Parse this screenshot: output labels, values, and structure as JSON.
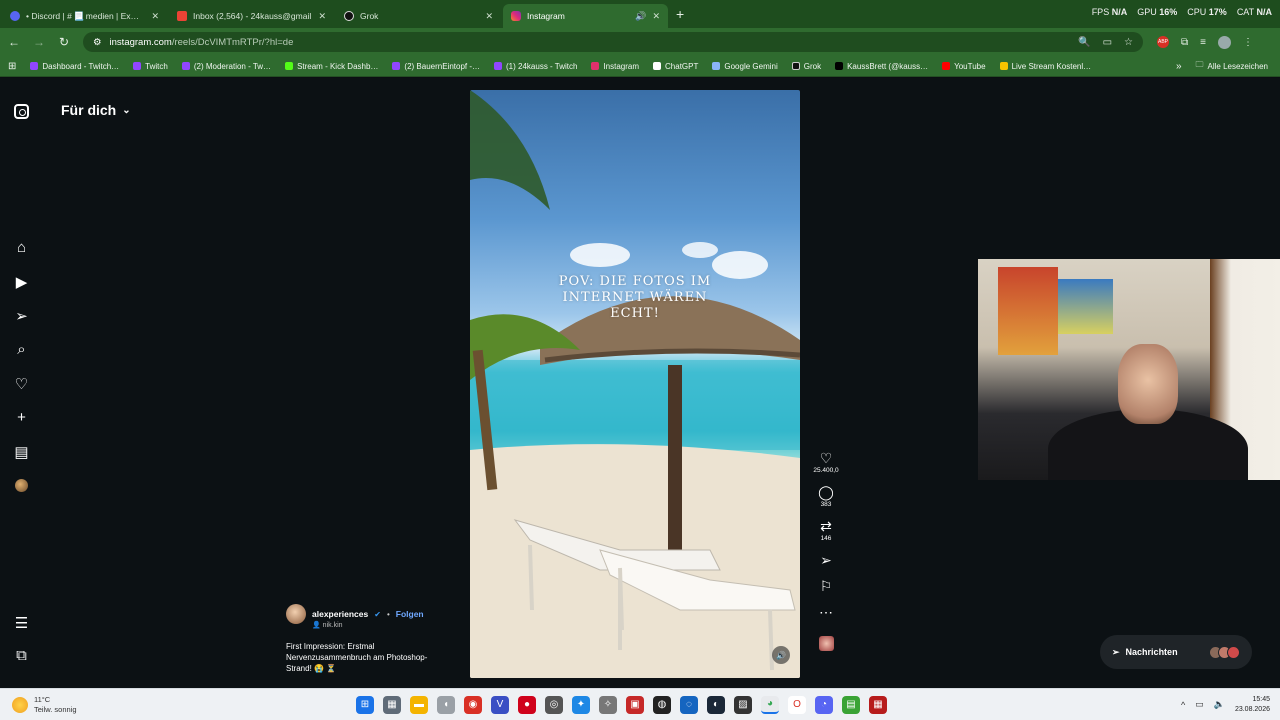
{
  "browser": {
    "tabs": [
      {
        "title": "• Discord | # 📃 medien | Ex…",
        "color": "#5865f2",
        "active": false
      },
      {
        "title": "Inbox (2,564) - 24kauss@gmail.",
        "color": "#ea4335",
        "active": false
      },
      {
        "title": "Grok",
        "color": "#111111",
        "active": false
      },
      {
        "title": "Instagram",
        "color": "#e1306c",
        "active": true
      }
    ],
    "new_tab": "+",
    "stats": {
      "fps_label": "FPS",
      "fps_value": "N/A",
      "gpu_label": "GPU",
      "gpu_value": "16%",
      "cpu_label": "CPU",
      "cpu_value": "17%",
      "cat_label": "CAT",
      "cat_value": "N/A"
    },
    "url_host": "instagram.com",
    "url_path": "/reels/DcVIMTmRTPr/?hl=de",
    "bookmarks": [
      {
        "label": "Dashboard - Twitch…",
        "color": "#9146ff"
      },
      {
        "label": "Twitch",
        "color": "#9146ff"
      },
      {
        "label": "(2) Moderation - Tw…",
        "color": "#9146ff"
      },
      {
        "label": "Stream - Kick Dashb…",
        "color": "#53fc18"
      },
      {
        "label": "(2) BauernEintopf -…",
        "color": "#9146ff"
      },
      {
        "label": "(1) 24kauss - Twitch",
        "color": "#9146ff"
      },
      {
        "label": "Instagram",
        "color": "#e1306c"
      },
      {
        "label": "ChatGPT",
        "color": "#ffffff"
      },
      {
        "label": "Google Gemini",
        "color": "#8ab4f8"
      },
      {
        "label": "Grok",
        "color": "#111111"
      },
      {
        "label": "KaussBrett (@kauss…",
        "color": "#000000"
      },
      {
        "label": "YouTube",
        "color": "#ff0000"
      },
      {
        "label": "Live Stream Kostenl…",
        "color": "#f5c400"
      }
    ],
    "bookmarks_more": "»",
    "all_bookmarks": "Alle Lesezeichen"
  },
  "instagram": {
    "feed_title": "Für dich",
    "reel": {
      "overlay_text_line1": "POV: DIE FOTOS IM",
      "overlay_text_line2": "INTERNET WÄREN",
      "overlay_text_line3": "ECHT!"
    },
    "author": {
      "name": "alexperiences",
      "follow": "Folgen",
      "audio": "nik.kin",
      "description_line1": "First Impression: Erstmal",
      "description_line2": "Nervenzusammenbruch am Photoshop-",
      "description_line3": "Strand! 😭 ⏳"
    },
    "actions": {
      "likes": "25.400,0",
      "comments": "383",
      "reposts": "146"
    },
    "messages_label": "Nachrichten"
  },
  "taskbar": {
    "weather_temp": "11°C",
    "weather_desc": "Teilw. sonnig",
    "time": "15:45",
    "date": "23.08.2026"
  }
}
